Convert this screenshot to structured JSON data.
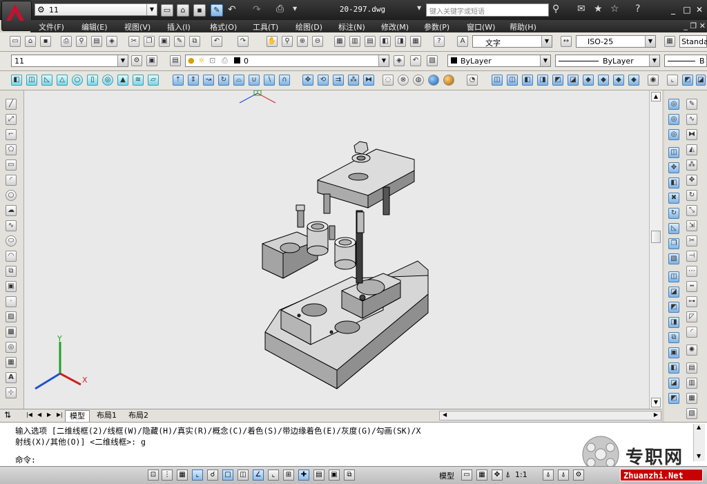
{
  "window": {
    "filename": "20-297.dwg",
    "workspace": "11",
    "search_placeholder": "键入关键字或短语",
    "controls": [
      "_",
      "□",
      "✕"
    ]
  },
  "menu": [
    "文件(F)",
    "编辑(E)",
    "视图(V)",
    "插入(I)",
    "格式(O)",
    "工具(T)",
    "绘图(D)",
    "标注(N)",
    "修改(M)",
    "参数(P)",
    "窗口(W)",
    "帮助(H)"
  ],
  "styles_toolbar": {
    "text_style": "文字",
    "dim_style": "ISO-25",
    "table_style": "Standa"
  },
  "layers_toolbar": {
    "workspace_value": "11",
    "layer_value": "0",
    "color_value": "ByLayer",
    "linetype_value": "ByLayer",
    "lineweight_value": "B"
  },
  "layout_tabs": [
    "模型",
    "布局1",
    "布局2"
  ],
  "command": {
    "line1": "输入选项 [二维线框(2)/线框(W)/隐藏(H)/真实(R)/概念(C)/着色(S)/带边缘着色(E)/灰度(G)/勾画(SK)/X",
    "line2": "射线(X)/其他(O)] <二维线框>: g",
    "prompt": "命令:"
  },
  "status": {
    "model_label": "模型",
    "scale_label": "1:1",
    "scale_icon": "annotation-scale-icon"
  },
  "ucs": {
    "x": "X",
    "y": "Y"
  },
  "watermark": {
    "text": "专职网",
    "url": "Zhuanzhi.Net"
  },
  "colors": {
    "accent_red": "#c8102e",
    "titlebar": "#262626",
    "canvas": "#e9e9e9"
  }
}
